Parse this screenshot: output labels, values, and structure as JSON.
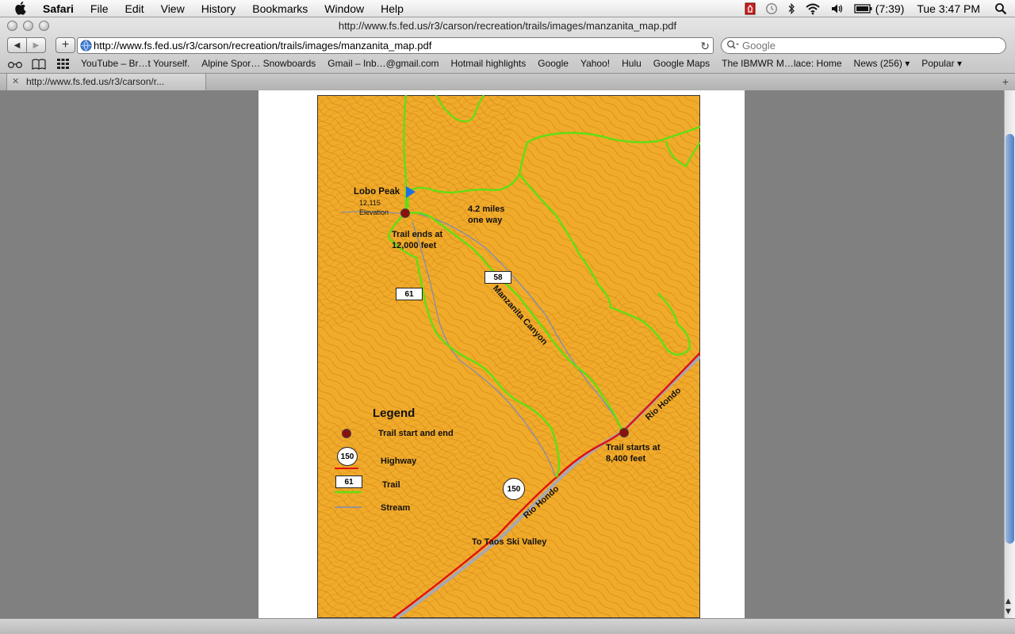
{
  "menubar": {
    "app_name": "Safari",
    "items": [
      "File",
      "Edit",
      "View",
      "History",
      "Bookmarks",
      "Window",
      "Help"
    ],
    "battery_text": "(7:39)",
    "clock": "Tue 3:47 PM"
  },
  "window": {
    "title": "http://www.fs.fed.us/r3/carson/recreation/trails/images/manzanita_map.pdf"
  },
  "toolbar": {
    "url": "http://www.fs.fed.us/r3/carson/recreation/trails/images/manzanita_map.pdf",
    "search_placeholder": "Google"
  },
  "bookmarks": [
    "YouTube – Br…t Yourself.",
    "Alpine Spor… Snowboards",
    "Gmail – Inb…@gmail.com",
    "Hotmail highlights",
    "Google",
    "Yahoo!",
    "Hulu",
    "Google Maps",
    "The IBMWR M…lace: Home",
    "News (256) ▾",
    "Popular ▾"
  ],
  "tab": {
    "title": "http://www.fs.fed.us/r3/carson/r..."
  },
  "map": {
    "lobo_peak": "Lobo Peak",
    "elevation_value": "12,115",
    "elevation_label": "Elevation",
    "distance_line1": "4.2 miles",
    "distance_line2": "one way",
    "trail_end_line1": "Trail ends at",
    "trail_end_line2": "12,000 feet",
    "canyon": "Manzanita Canyon",
    "trail_58": "58",
    "trail_61": "61",
    "rio_hondo": "Rio Hondo",
    "trail_start_line1": "Trail starts at",
    "trail_start_line2": "8,400 feet",
    "highway_150": "150",
    "taos": "To Taos Ski Valley",
    "legend_title": "Legend",
    "legend_trail_start": "Trail start and end",
    "legend_highway_num": "150",
    "legend_highway": "Highway",
    "legend_trail_num": "61",
    "legend_trail": "Trail",
    "legend_stream": "Stream",
    "colors": {
      "terrain": "#f0aa28",
      "contour": "#c87a10",
      "trail": "#5ee012",
      "highway": "#e01010",
      "stream": "#7a8cb8",
      "trailhead": "#8b1010",
      "peak_flag": "#1e6fe0"
    }
  }
}
